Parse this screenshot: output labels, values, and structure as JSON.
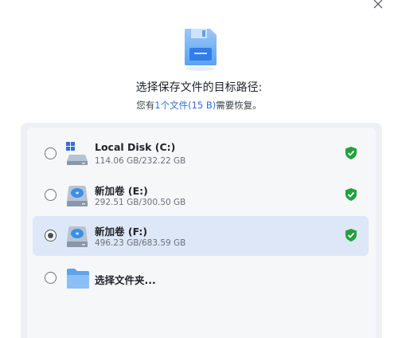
{
  "dialog": {
    "title": "选择保存文件的目标路径:",
    "subtitle_prefix": "您有",
    "subtitle_highlight": "1个文件(15 B)",
    "subtitle_suffix": "需要恢复。"
  },
  "drives": [
    {
      "name": "Local Disk (C:)",
      "size": "114.06 GB/232.22 GB",
      "selected": false,
      "icon": "windows-drive-icon",
      "status_icon": "shield-check-icon"
    },
    {
      "name": "新加卷 (E:)",
      "size": "292.51 GB/300.50 GB",
      "selected": false,
      "icon": "drive-icon",
      "status_icon": "shield-check-icon"
    },
    {
      "name": "新加卷 (F:)",
      "size": "496.23 GB/683.59 GB",
      "selected": true,
      "icon": "drive-icon",
      "status_icon": "shield-check-icon"
    }
  ],
  "folder_option": {
    "label": "选择文件夹...",
    "icon": "folder-icon"
  },
  "colors": {
    "accent": "#2f6fe0",
    "selected_row": "#dde7f7",
    "shield_green": "#1fa33a"
  }
}
